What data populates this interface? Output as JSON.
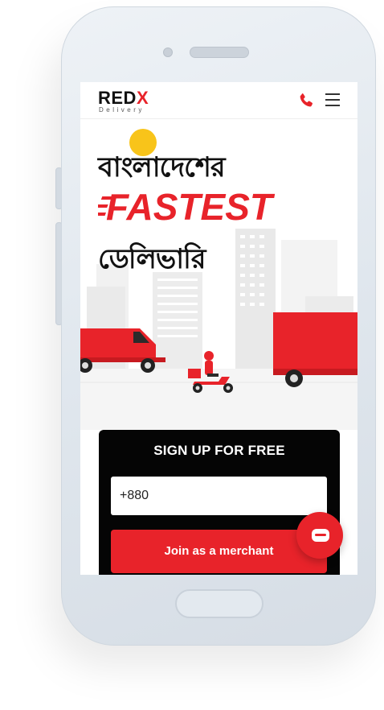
{
  "header": {
    "logo_main": "RED",
    "logo_accent": "X",
    "logo_sub": "Delivery",
    "call_icon": "phone-icon",
    "menu_icon": "hamburger-menu-icon"
  },
  "hero": {
    "line1": "বাংলাদেশের",
    "highlight": "FASTEST",
    "line3": "ডেলিভারি"
  },
  "signup": {
    "title": "SIGN UP FOR FREE",
    "phone_value": "+880",
    "join_label": "Join as a merchant"
  },
  "chat": {
    "icon": "chat-bubble-icon"
  },
  "colors": {
    "brand_red": "#e8232a",
    "dark": "#050505",
    "sun": "#f8c41a"
  }
}
